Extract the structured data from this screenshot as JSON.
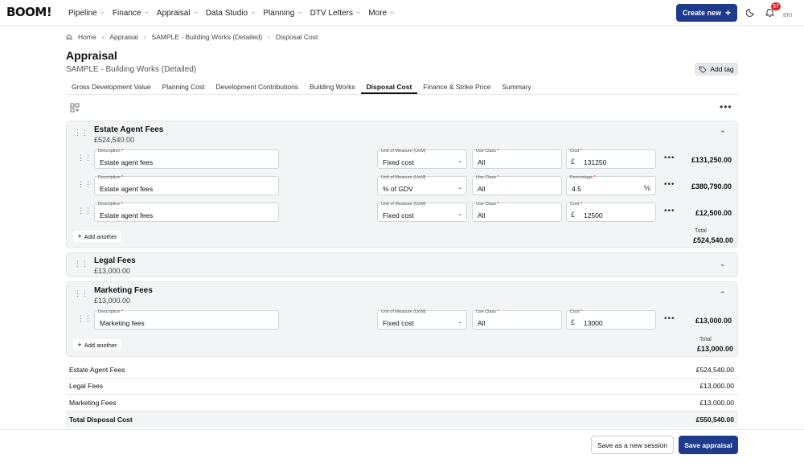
{
  "header": {
    "logo": "BOOM!",
    "nav": [
      {
        "label": "Pipeline"
      },
      {
        "label": "Finance"
      },
      {
        "label": "Appraisal"
      },
      {
        "label": "Data Studio"
      },
      {
        "label": "Planning"
      },
      {
        "label": "DTV Letters"
      },
      {
        "label": "More"
      }
    ],
    "create_new": "Create new",
    "notification_count": "57",
    "avatar_text": "BRI"
  },
  "breadcrumb": [
    "Home",
    "Appraisal",
    "SAMPLE - Building Works (Detailed)",
    "Disposal Cost"
  ],
  "page": {
    "title": "Appraisal",
    "subtitle": "SAMPLE - Building Works (Detailed)",
    "add_tag": "Add tag"
  },
  "tabs": [
    {
      "label": "Gross Development Value"
    },
    {
      "label": "Planning Cost"
    },
    {
      "label": "Development Contributions"
    },
    {
      "label": "Building Works"
    },
    {
      "label": "Disposal Cost",
      "active": true
    },
    {
      "label": "Finance & Strike Price"
    },
    {
      "label": "Summary"
    }
  ],
  "labels": {
    "description": "Description",
    "uom": "Unit of Measure (UoM)",
    "use_class": "Use Class",
    "cost": "Cost",
    "percentage": "Percentage",
    "add_another": "Add another",
    "total": "Total",
    "currency": "£",
    "percent": "%"
  },
  "sections": {
    "estate": {
      "title": "Estate Agent Fees",
      "subtitle": "£524,540.00",
      "rows": [
        {
          "description": "Estate agent fees",
          "uom": "Fixed cost",
          "use_class": "All",
          "value_label": "Cost",
          "value": "131250",
          "amount": "£131,250.00"
        },
        {
          "description": "Estate agent fees",
          "uom": "% of GDV",
          "use_class": "All",
          "value_label": "Percentage",
          "value": "4.5",
          "amount": "£380,790.00"
        },
        {
          "description": "Estate agent fees",
          "uom": "Fixed cost",
          "use_class": "All",
          "value_label": "Cost",
          "value": "12500",
          "amount": "£12,500.00"
        }
      ],
      "total": "£524,540.00"
    },
    "legal": {
      "title": "Legal Fees",
      "subtitle": "£13,000.00"
    },
    "marketing": {
      "title": "Marketing Fees",
      "subtitle": "£13,000.00",
      "rows": [
        {
          "description": "Marketing fees",
          "uom": "Fixed cost",
          "use_class": "All",
          "value_label": "Cost",
          "value": "13000",
          "amount": "£13,000.00"
        }
      ],
      "total": "£13,000.00"
    }
  },
  "summary": [
    {
      "label": "Estate Agent Fees",
      "value": "£524,540.00"
    },
    {
      "label": "Legal Fees",
      "value": "£13,000.00"
    },
    {
      "label": "Marketing Fees",
      "value": "£13,000.00"
    },
    {
      "label": "Total Disposal Cost",
      "value": "£550,540.00"
    }
  ],
  "footer": {
    "save_session": "Save as a new session",
    "save_appraisal": "Save appraisal"
  },
  "colors": {
    "primary": "#1e3a8a",
    "badge": "#dc2626"
  }
}
